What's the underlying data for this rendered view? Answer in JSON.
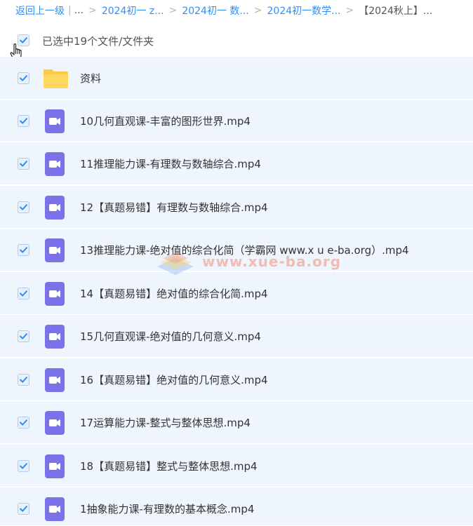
{
  "breadcrumb": {
    "back": "返回上一级",
    "pipe": "|",
    "ellipsis": "...",
    "sep": ">",
    "items": [
      "2024初一 z...",
      "2024初一 数...",
      "2024初一数学...",
      "【2024秋上】..."
    ]
  },
  "selection": {
    "text": "已选中19个文件/文件夹",
    "checked": true
  },
  "files": [
    {
      "name": "资料",
      "type": "folder",
      "checked": true
    },
    {
      "name": "10几何直观课-丰富的图形世界.mp4",
      "type": "video",
      "checked": true
    },
    {
      "name": "11推理能力课-有理数与数轴综合.mp4",
      "type": "video",
      "checked": true
    },
    {
      "name": "12【真题易错】有理数与数轴综合.mp4",
      "type": "video",
      "checked": true
    },
    {
      "name": "13推理能力课-绝对值的综合化简（学霸网 www.x u e-ba.org）.mp4",
      "type": "video",
      "checked": true
    },
    {
      "name": "14【真题易错】绝对值的综合化简.mp4",
      "type": "video",
      "checked": true
    },
    {
      "name": "15几何直观课-绝对值的几何意义.mp4",
      "type": "video",
      "checked": true
    },
    {
      "name": "16【真题易错】绝对值的几何意义.mp4",
      "type": "video",
      "checked": true
    },
    {
      "name": "17运算能力课-整式与整体思想.mp4",
      "type": "video",
      "checked": true
    },
    {
      "name": "18【真题易错】整式与整体思想.mp4",
      "type": "video",
      "checked": true
    },
    {
      "name": "1抽象能力课-有理数的基本概念.mp4",
      "type": "video",
      "checked": true
    }
  ],
  "watermark": {
    "text": "www.xue-ba.org"
  },
  "colors": {
    "link": "#2f8ff5",
    "row_bg": "#eff5fd",
    "video_icon": "#7b72e9",
    "folder_icon": "#ffd04f",
    "checkbox_check": "#2f8ff5"
  },
  "icons": {
    "checkbox": "check-icon",
    "video": "video-file-icon",
    "folder": "folder-icon",
    "cursor": "hand-cursor-icon"
  }
}
